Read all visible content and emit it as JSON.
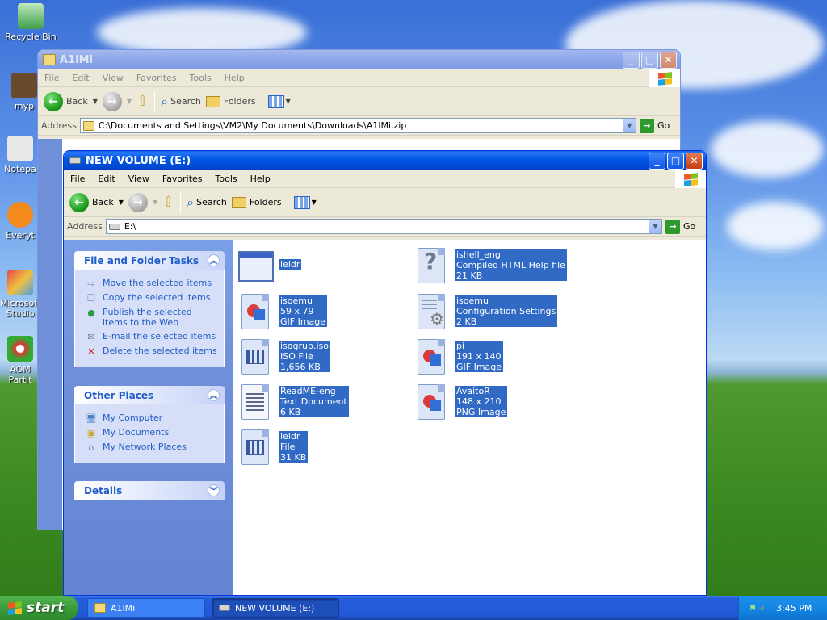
{
  "desktop": {
    "icons": [
      {
        "label": "Recycle Bin"
      },
      {
        "label": "myp"
      },
      {
        "label": "Notepa"
      },
      {
        "label": "Everyt"
      },
      {
        "label": "Microsoft Studio"
      },
      {
        "label": "AOM Partit"
      }
    ]
  },
  "back_window": {
    "title": "A1lMi",
    "menu": [
      "File",
      "Edit",
      "View",
      "Favorites",
      "Tools",
      "Help"
    ],
    "toolbar": {
      "back": "Back",
      "search": "Search",
      "folders": "Folders"
    },
    "address": {
      "label": "Address",
      "value": "C:\\Documents and Settings\\VM2\\My Documents\\Downloads\\A1lMi.zip",
      "go": "Go"
    }
  },
  "front_window": {
    "title": "NEW VOLUME (E:)",
    "menu": [
      "File",
      "Edit",
      "View",
      "Favorites",
      "Tools",
      "Help"
    ],
    "toolbar": {
      "back": "Back",
      "search": "Search",
      "folders": "Folders"
    },
    "address": {
      "label": "Address",
      "value": "E:\\",
      "go": "Go"
    },
    "tasks": {
      "title": "File and Folder Tasks",
      "items": [
        "Move the selected items",
        "Copy the selected items",
        "Publish the selected items to the Web",
        "E-mail the selected items",
        "Delete the selected items"
      ]
    },
    "places": {
      "title": "Other Places",
      "items": [
        "My Computer",
        "My Documents",
        "My Network Places"
      ]
    },
    "details": {
      "title": "Details"
    },
    "files": [
      {
        "name": "ieldr",
        "line2": "",
        "line3": "",
        "icon": "window-app-icon"
      },
      {
        "name": "ishell_eng",
        "line2": "Compiled HTML Help file",
        "line3": "21 KB",
        "icon": "help-file-icon"
      },
      {
        "name": "isoemu",
        "line2": "59 x 79",
        "line3": "GIF Image",
        "icon": "image-file-icon"
      },
      {
        "name": "isoemu",
        "line2": "Configuration Settings",
        "line3": "2 KB",
        "icon": "config-file-icon"
      },
      {
        "name": "isogrub.iso",
        "line2": "ISO File",
        "line3": "1,656 KB",
        "icon": "generic-file-icon"
      },
      {
        "name": "pi",
        "line2": "191 x 140",
        "line3": "GIF Image",
        "icon": "image-file-icon"
      },
      {
        "name": "ReadME-eng",
        "line2": "Text Document",
        "line3": "6 KB",
        "icon": "text-file-icon"
      },
      {
        "name": "AvaitoR",
        "line2": "148 x 210",
        "line3": "PNG Image",
        "icon": "image-file-icon"
      },
      {
        "name": "ieldr",
        "line2": "File",
        "line3": "31 KB",
        "icon": "generic-file-icon"
      }
    ]
  },
  "taskbar": {
    "start": "start",
    "tasks": [
      "A1lMi",
      "NEW VOLUME (E:)"
    ],
    "clock": "3:45 PM"
  },
  "colors": {
    "selection": "#316ac5",
    "link": "#215dc6",
    "titlebar": "#0058e6"
  }
}
